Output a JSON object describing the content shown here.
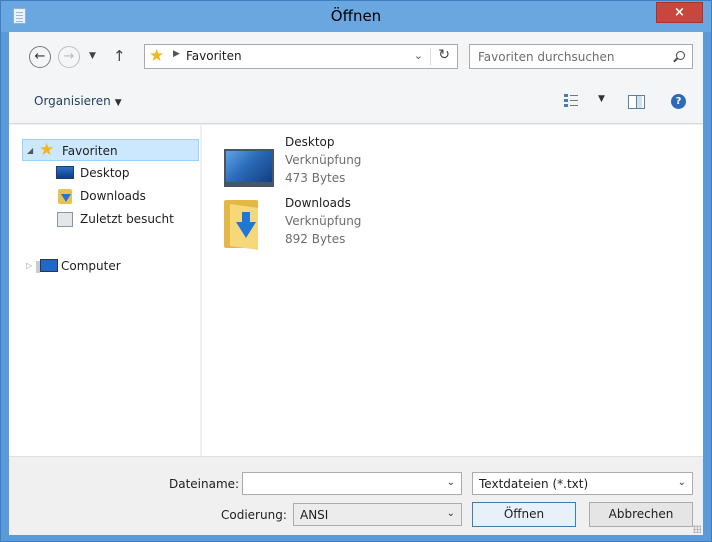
{
  "window": {
    "title": "Öffnen",
    "close_label": "×",
    "accent": "#5b9ad8"
  },
  "address_bar": {
    "back_icon": "back-arrow-icon",
    "forward_icon": "forward-arrow-icon",
    "recent_icon": "chevron-down-icon",
    "up_icon": "up-arrow-icon",
    "up_glyph": "↑",
    "path_icon": "star-icon",
    "path": "Favoriten",
    "refresh_glyph": "↻"
  },
  "search": {
    "placeholder": "Favoriten durchsuchen"
  },
  "toolbar": {
    "organize_label": "Organisieren",
    "view_icon": "view-options-icon",
    "pane_icon": "preview-pane-icon",
    "help_glyph": "?"
  },
  "nav_pane": {
    "favorites_label": "Favoriten",
    "items": [
      {
        "label": "Desktop",
        "icon": "desktop-icon"
      },
      {
        "label": "Downloads",
        "icon": "downloads-folder-icon"
      },
      {
        "label": "Zuletzt besucht",
        "icon": "recent-places-icon"
      }
    ],
    "computer_label": "Computer"
  },
  "files": [
    {
      "name": "Desktop",
      "type": "Verknüpfung",
      "size": "473 Bytes",
      "icon": "desktop-shortcut-icon"
    },
    {
      "name": "Downloads",
      "type": "Verknüpfung",
      "size": "892 Bytes",
      "icon": "downloads-folder-icon"
    }
  ],
  "bottom": {
    "filename_label": "Dateiname:",
    "filename_value": "",
    "filetype_value": "Textdateien (*.txt)",
    "encoding_label": "Codierung:",
    "encoding_value": "ANSI",
    "open_label": "Öffnen",
    "cancel_label": "Abbrechen"
  }
}
